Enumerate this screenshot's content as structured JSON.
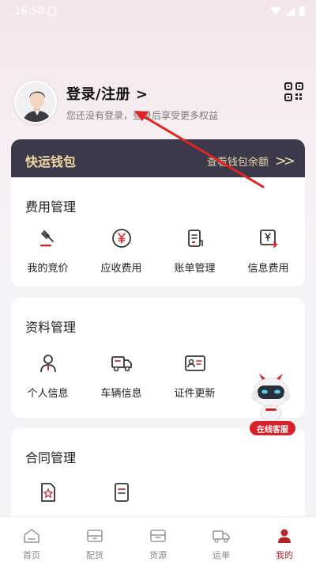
{
  "status_bar": {
    "time": "16:50"
  },
  "profile": {
    "title": "登录/注册 >",
    "subtitle": "您还没有登录，登录后享受更多权益"
  },
  "wallet": {
    "title": "快运钱包",
    "link": "查看钱包余额",
    "chevron": ">>"
  },
  "fee": {
    "title": "费用管理",
    "items": [
      {
        "label": "我的竞价",
        "icon": "gavel-icon"
      },
      {
        "label": "应收费用",
        "icon": "yen-circle-icon"
      },
      {
        "label": "账单管理",
        "icon": "bill-icon"
      },
      {
        "label": "信息费用",
        "icon": "yen-document-icon"
      }
    ]
  },
  "data": {
    "title": "资料管理",
    "items": [
      {
        "label": "个人信息",
        "icon": "person-icon"
      },
      {
        "label": "车辆信息",
        "icon": "truck-icon"
      },
      {
        "label": "证件更新",
        "icon": "id-card-icon"
      }
    ]
  },
  "contract": {
    "title": "合同管理",
    "items": [
      {
        "icon": "contract-star-icon"
      },
      {
        "icon": "contract-document-icon"
      }
    ]
  },
  "service": {
    "label": "在线客服"
  },
  "tabbar": {
    "tabs": [
      {
        "label": "首页"
      },
      {
        "label": "配货"
      },
      {
        "label": "货源"
      },
      {
        "label": "运单"
      },
      {
        "label": "我的"
      }
    ],
    "active": "我的"
  },
  "colors": {
    "accent": "#d8222a",
    "wallet_bg": "#3c3a4a",
    "wallet_text": "#f1d9a4",
    "active_tab": "#b3262c"
  }
}
